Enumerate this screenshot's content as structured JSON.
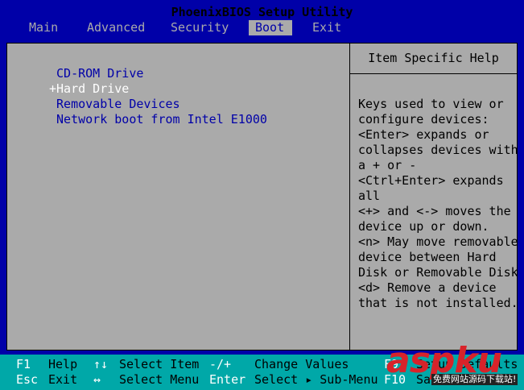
{
  "header": {
    "title": "PhoenixBIOS Setup Utility",
    "menus": [
      "Main",
      "Advanced",
      "Security",
      "Boot",
      "Exit"
    ],
    "active_menu": "Boot"
  },
  "boot": {
    "items": [
      {
        "label": " CD-ROM Drive"
      },
      {
        "label": "+Hard Drive"
      },
      {
        "label": " Removable Devices"
      },
      {
        "label": " Network boot from Intel E1000"
      }
    ],
    "selected_index": 1
  },
  "help": {
    "title": "Item Specific Help",
    "text": "Keys used to view or\nconfigure devices:\n<Enter> expands or\ncollapses devices with\na + or -\n<Ctrl+Enter> expands\nall\n<+> and <-> moves the\ndevice up or down.\n<n> May move removable\ndevice between Hard\nDisk or Removable Disk\n<d> Remove a device\nthat is not installed."
  },
  "footer": {
    "row1": [
      {
        "key": "F1",
        "label": "Help"
      },
      {
        "key": "↑↓",
        "label": "Select Item"
      },
      {
        "key": "-/+",
        "label": "Change Values"
      },
      {
        "key": "F9",
        "label": "Setup Defaults"
      }
    ],
    "row2": [
      {
        "key": "Esc",
        "label": "Exit"
      },
      {
        "key": "↔",
        "label": "Select Menu"
      },
      {
        "key": "Enter",
        "label": "Select ▸ Sub-Menu"
      },
      {
        "key": "F10",
        "label": "Save and Exit"
      }
    ]
  },
  "watermark": {
    "logo": "aspku",
    "tagline": "免费网站源码下载站!"
  },
  "colors": {
    "background": "#0000a8",
    "panel": "#aaaaaa",
    "footer": "#00a8a8",
    "selected_text": "#ffffff",
    "watermark": "#d8232a"
  }
}
